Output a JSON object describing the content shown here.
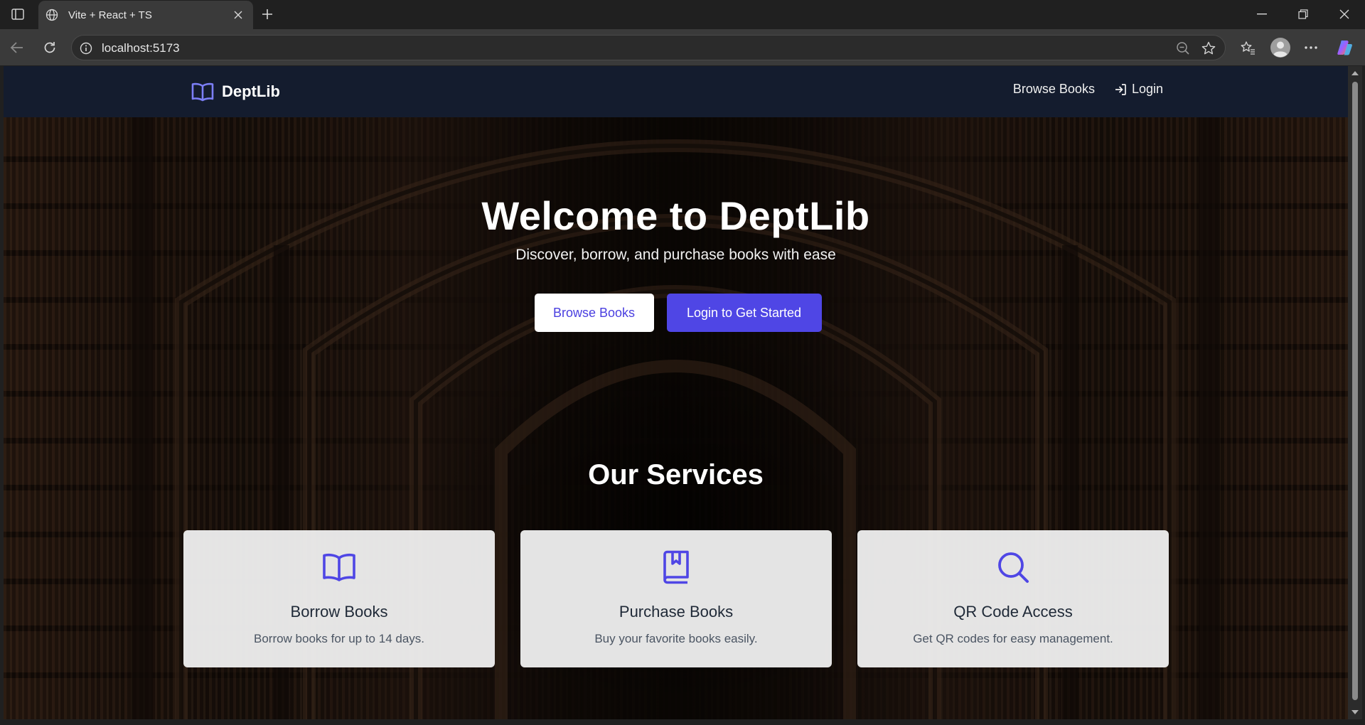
{
  "browser": {
    "tab_title": "Vite + React + TS",
    "url": "localhost:5173"
  },
  "site": {
    "logo_text": "DeptLib",
    "nav": {
      "browse_label": "Browse Books",
      "login_label": "Login"
    }
  },
  "hero": {
    "title": "Welcome to DeptLib",
    "subtitle": "Discover, borrow, and purchase books with ease",
    "primary_button": "Browse Books",
    "secondary_button": "Login to Get Started"
  },
  "services": {
    "heading": "Our Services",
    "items": [
      {
        "icon": "book-open-icon",
        "title": "Borrow Books",
        "description": "Borrow books for up to 14 days."
      },
      {
        "icon": "book-bookmark-icon",
        "title": "Purchase Books",
        "description": "Buy your favorite books easily."
      },
      {
        "icon": "search-icon",
        "title": "QR Code Access",
        "description": "Get QR codes for easy management."
      }
    ]
  },
  "colors": {
    "accent": "#4f46e5",
    "navbar": "#141c2e",
    "card_bg": "#f0f0f0"
  }
}
